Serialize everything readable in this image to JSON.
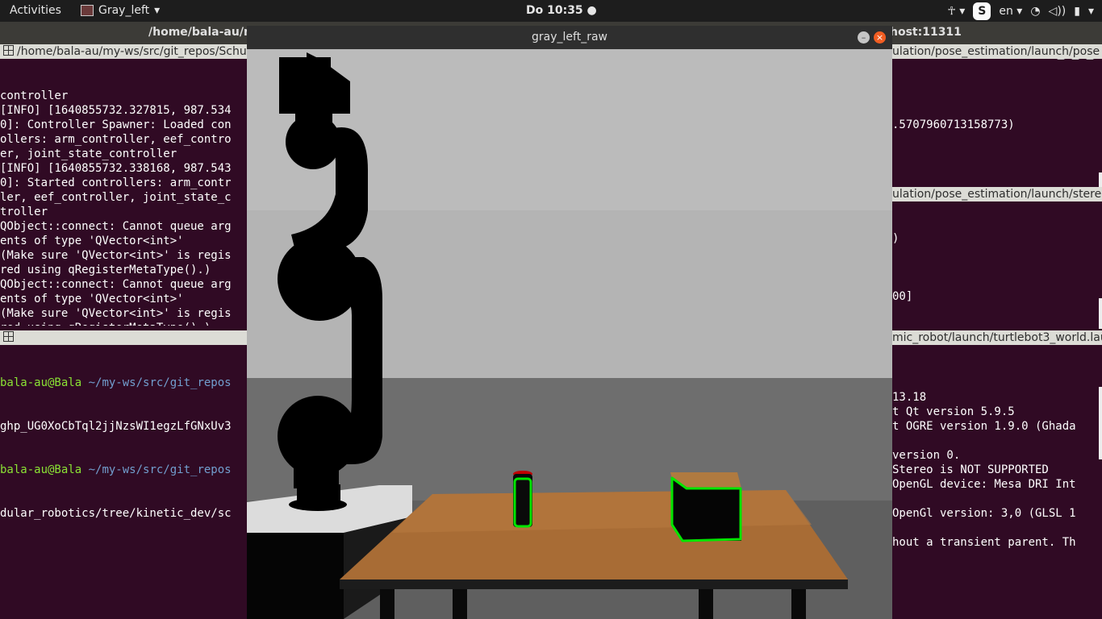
{
  "topbar": {
    "activities": "Activities",
    "app_name": "Gray_left",
    "clock": "Do 10:35",
    "language": "en",
    "tray_icons": [
      "accessibility-icon",
      "skype-icon",
      "wifi-icon",
      "volume-icon",
      "battery-icon",
      "power-menu-icon"
    ],
    "skype_letter": "S"
  },
  "term_top_left": {
    "title_path": "/home/bala-au/my-ws/src/git_repos/Schu",
    "background_title": "/home/bala-au/m",
    "lines": [
      "controller",
      "[INFO] [1640855732.327815, 987.534",
      "0]: Controller Spawner: Loaded con",
      "ollers: arm_controller, eef_contro",
      "er, joint_state_controller",
      "[INFO] [1640855732.338168, 987.543",
      "0]: Started controllers: arm_contr",
      "ler, eef_controller, joint_state_c",
      "troller",
      "QObject::connect: Cannot queue arg",
      "ents of type 'QVector<int>'",
      "(Make sure 'QVector<int>' is regis",
      "red using qRegisterMetaType().)",
      "QObject::connect: Cannot queue arg",
      "ents of type 'QVector<int>'",
      "(Make sure 'QVector<int>' is regis",
      "red using qRegisterMetaType().)"
    ]
  },
  "term_bottom_left": {
    "lines": [
      {
        "user": "bala-au@Bala",
        "path": "~/my-ws/src/git_repos"
      },
      {
        "text": "ghp_UG0XoCbTql2jjNzsWI1egzLfGNxUv3"
      },
      {
        "user": "bala-au@Bala",
        "path": "~/my-ws/src/git_repos"
      },
      {
        "text": "dular_robotics/tree/kinetic_dev/sc"
      }
    ]
  },
  "right_panes": {
    "top_title": "host:11311",
    "pane1_title": "ulation/pose_estimation/launch/pose",
    "pane1_line": ".5707960713158773)",
    "pane2_title": "ulation/pose_estimation/launch/stere",
    "pane2_line1": ")",
    "pane2_line2": "00]",
    "pane3_title": "mic_robot/launch/turtlebot3_world.lau",
    "pane3_lines": [
      "13.18",
      "t Qt version 5.9.5",
      "t OGRE version 1.9.0 (Ghada",
      "",
      "version 0.",
      "Stereo is NOT SUPPORTED",
      "OpenGL device: Mesa DRI Int",
      "",
      "OpenGl version: 3,0 (GLSL 1",
      "",
      "hout a transient parent. Th"
    ]
  },
  "image_window": {
    "title": "gray_left_raw"
  },
  "colors": {
    "terminal_bg": "#300a24",
    "detection_outline": "#00e600",
    "close_button": "#f15d22"
  }
}
